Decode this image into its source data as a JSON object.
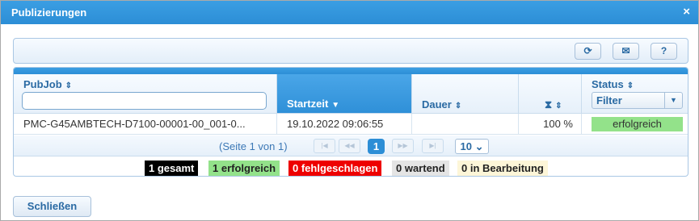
{
  "dialog": {
    "title": "Publizierungen",
    "close_icon": "×"
  },
  "toolbar": {
    "refresh_icon": "⟳",
    "mail_icon": "✉",
    "help_label": "?"
  },
  "columns": {
    "pubjob": {
      "label": "PubJob",
      "filter_value": ""
    },
    "startzeit": {
      "label": "Startzeit",
      "sort_icon": "▼"
    },
    "dauer": {
      "label": "Dauer"
    },
    "progress": {
      "icon": "⧗"
    },
    "status": {
      "label": "Status",
      "filter_label": "Filter",
      "filter_caret": "▼"
    },
    "sort_icon": "⇕"
  },
  "rows": [
    {
      "pubjob": "PMC-G45AMBTECH-D7100-00001-00_001-0...",
      "startzeit": "19.10.2022 09:06:55",
      "dauer": "",
      "progress": "100 %",
      "status": "erfolgreich",
      "status_color": "#93e28a"
    }
  ],
  "pager": {
    "info": "(Seite 1 von 1)",
    "first": "|◀",
    "prev": "◀◀",
    "current_page": "1",
    "next": "▶▶",
    "last": "▶|",
    "page_size": "10 ⌄"
  },
  "summary": {
    "total": "1 gesamt",
    "success": "1 erfolgreich",
    "failed": "0 fehlgeschlagen",
    "waiting": "0 wartend",
    "in_progress": "0 in Bearbeitung",
    "colors": {
      "total": "#000000",
      "success": "#93e28a",
      "failed": "#ee0000",
      "waiting": "#e4e4e4",
      "in_progress": "#fdf6d8"
    }
  },
  "footer": {
    "close_label": "Schließen"
  }
}
